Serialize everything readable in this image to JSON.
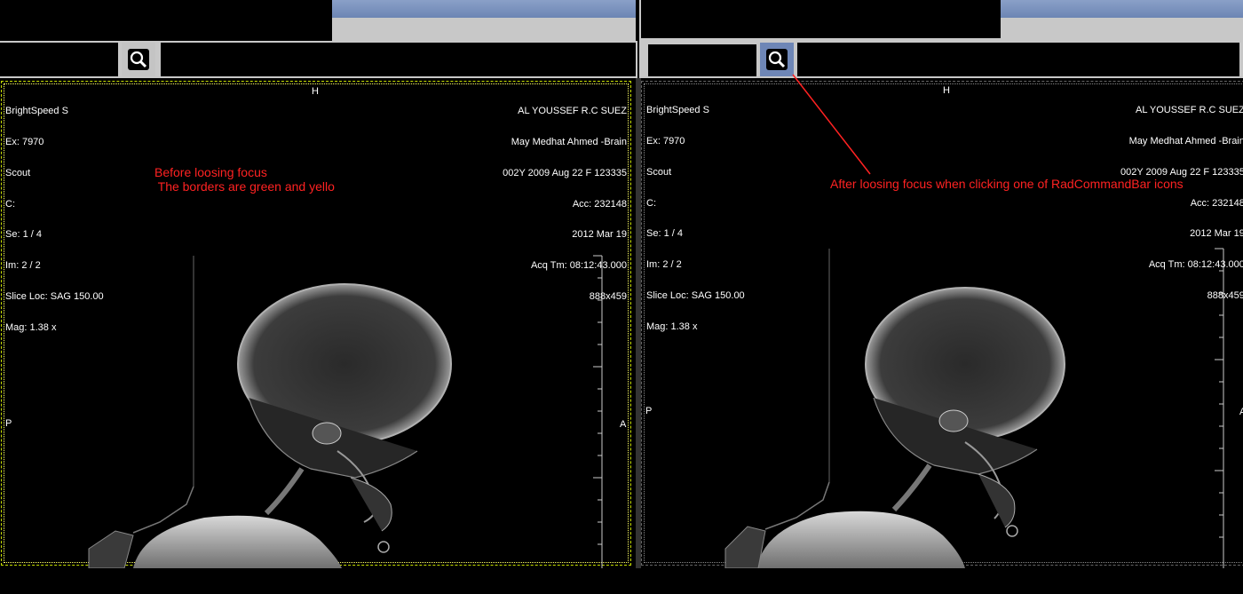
{
  "left_viewer": {
    "overlay_left": [
      "BrightSpeed S",
      "Ex: 7970",
      "Scout",
      "C:",
      "Se: 1 / 4",
      "Im: 2 / 2",
      "Slice Loc: SAG 150.00",
      "Mag: 1.38 x"
    ],
    "overlay_right": [
      "AL YOUSSEF R.C SUEZ",
      "May Medhat Ahmed -Brain",
      "002Y 2009 Aug 22 F 123335",
      "Acc: 232148",
      "2012 Mar 19",
      "Acq Tm: 08:12:43.000",
      "888x459"
    ],
    "orient_top": "H",
    "orient_left": "P",
    "orient_right": "A",
    "annotation": "Before loosing focus\n The borders are green and yello",
    "border_colors": {
      "outer": "#c8e000",
      "inner": "#ffff66"
    }
  },
  "right_viewer": {
    "overlay_left": [
      "BrightSpeed S",
      "Ex: 7970",
      "Scout",
      "C:",
      "Se: 1 / 4",
      "Im: 2 / 2",
      "Slice Loc: SAG 150.00",
      "Mag: 1.38 x"
    ],
    "overlay_right": [
      "AL YOUSSEF R.C SUEZ",
      "May Medhat Ahmed -Brain",
      "002Y 2009 Aug 22 F 123335",
      "Acc: 232148",
      "2012 Mar 19",
      "Acq Tm: 08:12:43.000",
      "888x459"
    ],
    "orient_top": "H",
    "orient_left": "P",
    "orient_right": "A",
    "annotation": "After loosing focus when clicking one of RadCommandBar icons",
    "border_colors": {
      "outer": "#666666",
      "inner": "#888888"
    }
  },
  "colors": {
    "annotation_red": "#ff2222",
    "toolbar_blue": "#7088b8",
    "zoom_button_active": "#6e86b6"
  },
  "icons": [
    "zoom-icon"
  ]
}
